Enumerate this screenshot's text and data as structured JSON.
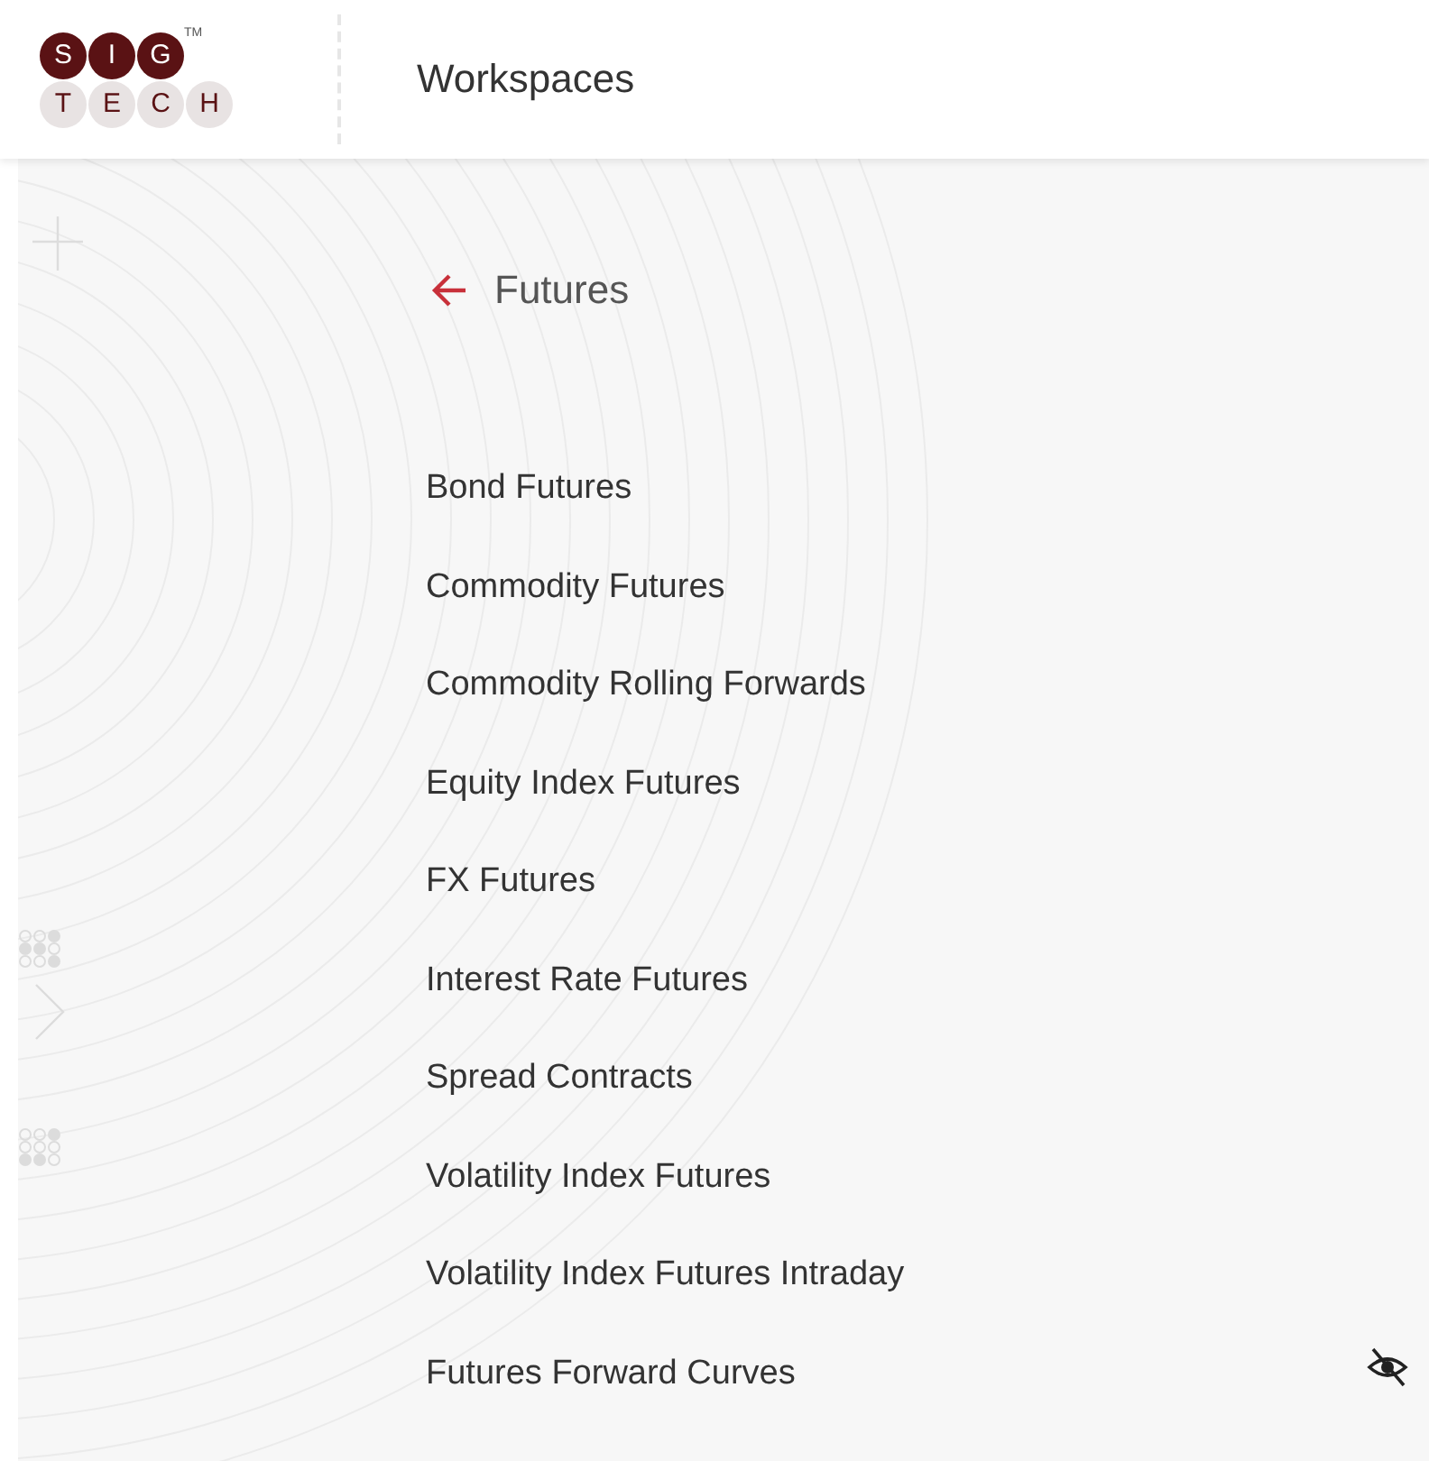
{
  "logo": {
    "top_letters": [
      "S",
      "I",
      "G"
    ],
    "bottom_letters": [
      "T",
      "E",
      "C",
      "H"
    ],
    "trademark": "TM"
  },
  "header": {
    "title": "Workspaces"
  },
  "page": {
    "title": "Futures"
  },
  "items": [
    {
      "label": "Bond Futures",
      "hidden": false
    },
    {
      "label": "Commodity Futures",
      "hidden": false
    },
    {
      "label": "Commodity Rolling Forwards",
      "hidden": false
    },
    {
      "label": "Equity Index Futures",
      "hidden": false
    },
    {
      "label": "FX Futures",
      "hidden": false
    },
    {
      "label": "Interest Rate Futures",
      "hidden": false
    },
    {
      "label": "Spread Contracts",
      "hidden": false
    },
    {
      "label": "Volatility Index Futures",
      "hidden": false
    },
    {
      "label": "Volatility Index Futures Intraday",
      "hidden": false
    },
    {
      "label": "Futures Forward Curves",
      "hidden": true
    }
  ]
}
